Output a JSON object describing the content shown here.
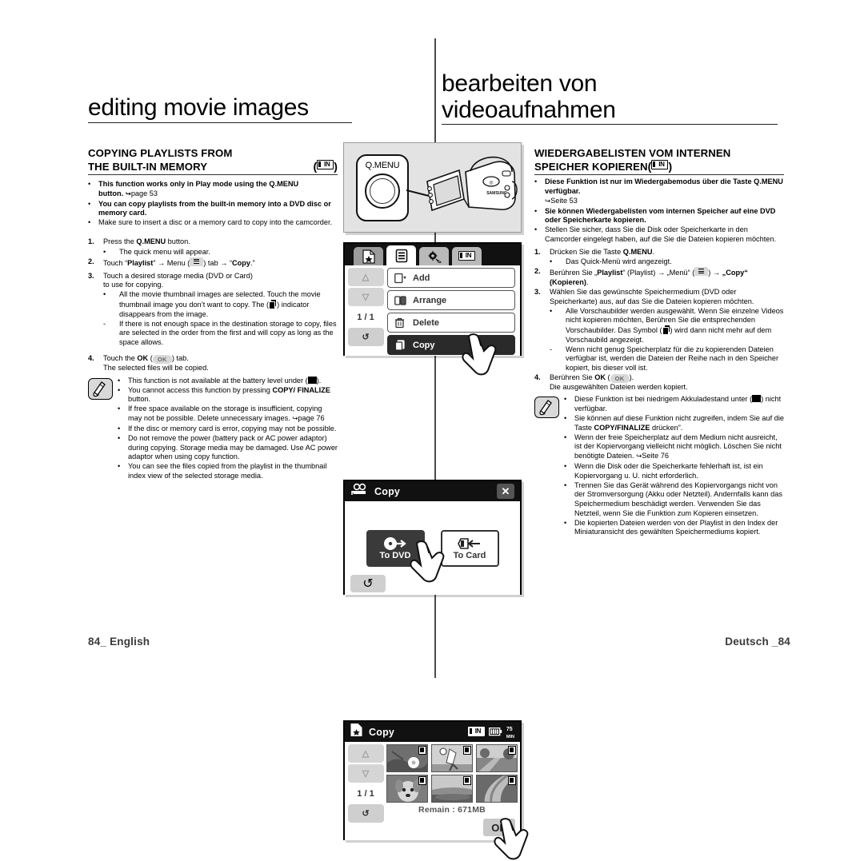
{
  "page": {
    "left_header": "editing movie images",
    "right_header_line1": "bearbeiten von",
    "right_header_line2": "videoaufnahmen",
    "footer_left": "84_ English",
    "footer_right": "Deutsch _84"
  },
  "left": {
    "heading_line1": "COPYING PLAYLISTS FROM",
    "heading_line2": "THE BUILT-IN MEMORY",
    "heading_icon": "in-memory-icon",
    "intro": [
      {
        "marker": "•",
        "text": "This function works only in Play mode using the Q.MENU button. ↪page 53",
        "bold": true
      },
      {
        "marker": "•",
        "text": "You can copy playlists from the built-in memory into a DVD disc or memory card.",
        "bold": true
      },
      {
        "marker": "•",
        "text": "Make sure to insert a disc or a memory card to copy into the camcorder.",
        "bold": false
      }
    ],
    "steps": [
      {
        "num": "1.",
        "text": "Press the Q.MENU button."
      },
      {
        "num": "",
        "sub": "•",
        "text": "The quick menu will appear."
      },
      {
        "num": "2.",
        "text": "Touch “Playlist” → Menu (  ) tab → “Copy.”"
      },
      {
        "num": "3.",
        "text": "Touch a desired storage media (DVD or Card) to use for copying."
      },
      {
        "num": "",
        "sub": "•",
        "text": "All the movie thumbnail images are selected. Touch the movie thumbnail image you don’t want to copy. The ( ) indicator disappears from the image."
      },
      {
        "num": "",
        "sub": "-",
        "text": "If there is not enough space in the destination storage to copy, files are selected in the order from the first and will copy as long as the space allows."
      },
      {
        "num": "4.",
        "text": "Touch the OK (  ) tab."
      },
      {
        "num": "",
        "text": "The selected files will be copied."
      }
    ],
    "notes": [
      "This function is not available at the battery level under ( ).",
      "You cannot access this function by pressing COPY/FINALIZE button.",
      "If free space available on the storage is insufficient, copying may not be possible. Delete unnecessary images. ↪page 76",
      "If the disc or memory card is error, copying may not be possible.",
      "Do not remove the power (battery pack or AC power adaptor) during copying. Storage media may be damaged. Use AC power adaptor when using copy function.",
      "You can see the files copied from the playlist in the thumbnail index view of the selected storage media."
    ]
  },
  "right": {
    "heading_line1": "WIEDERGABELISTEN VOM INTERNEN",
    "heading_line2": "SPEICHER KOPIEREN",
    "heading_icon": "in-memory-icon",
    "intro": [
      {
        "marker": "•",
        "text": "Diese Funktion ist nur im Wiedergabemodus über die Taste Q.MENU verfügbar.",
        "bold": true
      },
      {
        "marker": "",
        "text": "↪Seite 53",
        "bold": false
      },
      {
        "marker": "•",
        "text": "Sie können Wiedergabelisten vom internen Speicher auf eine DVD oder Speicherkarte kopieren.",
        "bold": true
      },
      {
        "marker": "•",
        "text": "Stellen Sie sicher, dass Sie die Disk oder Speicherkarte in den Camcorder eingelegt haben, auf die Sie die Dateien kopieren möchten.",
        "bold": false
      }
    ],
    "steps": [
      {
        "num": "1.",
        "text": "Drücken Sie die Taste Q.MENU."
      },
      {
        "num": "",
        "sub": "•",
        "text": "Das Quick-Menü wird angezeigt."
      },
      {
        "num": "2.",
        "text": "Berühren Sie „Playlist“ (Playlist) → „Menü“ (  ) → „Copy“ (Kopieren)."
      },
      {
        "num": "3.",
        "text": "Wählen Sie das gewünschte Speichermedium (DVD oder Speicherkarte) aus, auf das Sie die Dateien kopieren möchten."
      },
      {
        "num": "",
        "sub": "•",
        "text": "Alle Vorschaubilder werden ausgewählt. Wenn Sie einzelne Videos nicht kopieren möchten, Berühren Sie die entsprechenden Vorschaubilder. Das Symbol ( ) wird dann nicht mehr auf dem Vorschaubild angezeigt."
      },
      {
        "num": "",
        "sub": "-",
        "text": "Wenn nicht genug Speicherplatz für die zu kopierenden Dateien verfügbar ist, werden die Dateien der Reihe nach in den Speicher kopiert, bis dieser voll ist."
      },
      {
        "num": "4.",
        "text": "Berühren Sie OK (  )."
      },
      {
        "num": "",
        "text": "Die ausgewählten Dateien werden kopiert."
      }
    ],
    "notes": [
      "Diese Funktion ist bei niedrigem Akkuladestand unter ( ) nicht verfügbar.",
      "Sie können auf diese Funktion nicht zugreifen, indem Sie auf die Taste COPY/FINALIZE drücken”.",
      "Wenn der freie Speicherplatz auf dem Medium nicht ausreicht, ist der Kopiervorgang vielleicht nicht möglich. Löschen Sie nicht benötigte Dateien. ↪Seite 76",
      "Wenn die Disk oder die Speicherkarte fehlerhaft ist, ist ein Kopiervorgang u. U. nicht erforderlich.",
      "Trennen Sie das Gerät während des Kopiervorgangs nicht von der Stromversorgung (Akku oder Netzteil). Andernfalls kann das Speichermedium beschädigt werden. Verwenden Sie das Netzteil, wenn Sie die Funktion zum Kopieren einsetzen.",
      "Die kopierten Dateien werden von der Playlist in den Index der Miniaturansicht des gewählten Speichermediums kopiert."
    ]
  },
  "figures": {
    "camcorder": {
      "button_label": "Q.MENU",
      "brand": "SAMSUNG"
    },
    "playlist_menu": {
      "tabs": [
        "star-page-icon",
        "menu-list-icon",
        "settings-gear-icon",
        "in-memory-icon"
      ],
      "page_indicator": "1 / 1",
      "items": [
        {
          "label": "Add",
          "icon": "add-icon",
          "selected": false
        },
        {
          "label": "Arrange",
          "icon": "arrange-icon",
          "selected": false
        },
        {
          "label": "Delete",
          "icon": "trash-icon",
          "selected": false
        },
        {
          "label": "Copy",
          "icon": "copy-icon",
          "selected": true
        }
      ],
      "up_icon": "chevron-up-icon",
      "down_icon": "chevron-down-icon",
      "back_icon": "back-arrow-icon"
    },
    "copy_target": {
      "title": "Copy",
      "title_icon": "movie-camera-icon",
      "close_icon": "close-icon",
      "options": [
        {
          "label": "To DVD",
          "icon": "to-dvd-icon",
          "selected": true
        },
        {
          "label": "To Card",
          "icon": "to-card-icon",
          "selected": false
        }
      ],
      "back_icon": "back-arrow-icon"
    },
    "thumbnails": {
      "title": "Copy",
      "title_icon": "star-page-icon",
      "storage_icon": "in-memory-icon",
      "battery_icon": "battery-icon",
      "battery_time": "75",
      "battery_unit": "MIN",
      "page_indicator": "1 / 1",
      "remain_label": "Remain : 671MB",
      "ok_label": "OK",
      "up_icon": "chevron-up-icon",
      "down_icon": "chevron-down-icon",
      "back_icon": "back-arrow-icon",
      "cells": [
        {
          "name": "thumb-flower"
        },
        {
          "name": "thumb-soccer"
        },
        {
          "name": "thumb-road"
        },
        {
          "name": "thumb-dog"
        },
        {
          "name": "thumb-field"
        },
        {
          "name": "thumb-slide"
        }
      ]
    }
  }
}
